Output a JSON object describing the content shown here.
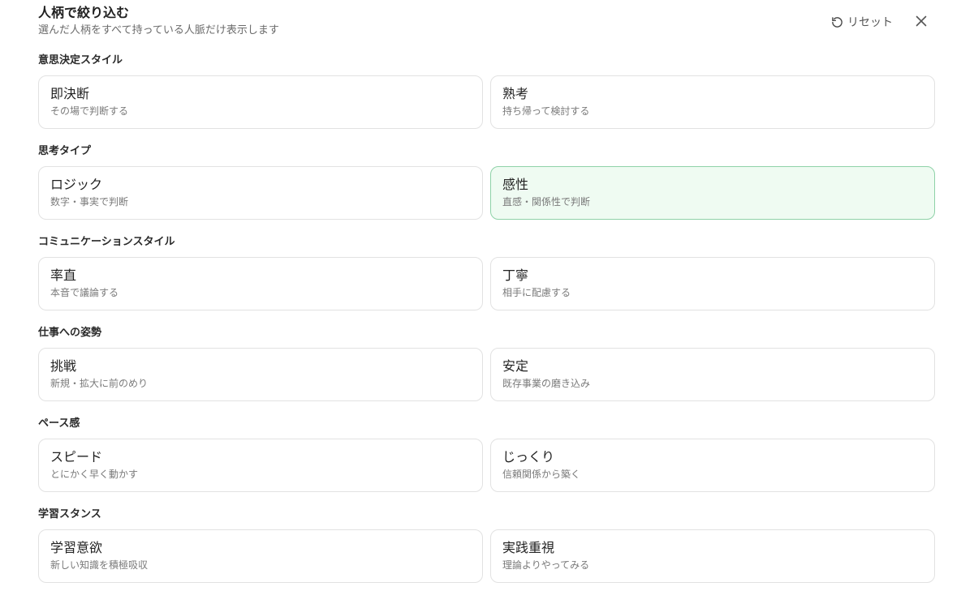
{
  "header": {
    "title": "人柄で絞り込む",
    "subtitle": "選んだ人柄をすべて持っている人脈だけ表示します",
    "reset_label": "リセット",
    "reset_icon": "rotate-ccw-icon",
    "close_icon": "close-icon"
  },
  "colors": {
    "selected_background": "#effbf2",
    "selected_border": "#8fd2a8",
    "card_border": "#e2e2e2"
  },
  "sections": [
    {
      "title": "意思決定スタイル",
      "options": [
        {
          "label": "即決断",
          "description": "その場で判断する",
          "selected": false
        },
        {
          "label": "熟考",
          "description": "持ち帰って検討する",
          "selected": false
        }
      ]
    },
    {
      "title": "思考タイプ",
      "options": [
        {
          "label": "ロジック",
          "description": "数字・事実で判断",
          "selected": false
        },
        {
          "label": "感性",
          "description": "直感・関係性で判断",
          "selected": true
        }
      ]
    },
    {
      "title": "コミュニケーションスタイル",
      "options": [
        {
          "label": "率直",
          "description": "本音で議論する",
          "selected": false
        },
        {
          "label": "丁寧",
          "description": "相手に配慮する",
          "selected": false
        }
      ]
    },
    {
      "title": "仕事への姿勢",
      "options": [
        {
          "label": "挑戦",
          "description": "新規・拡大に前のめり",
          "selected": false
        },
        {
          "label": "安定",
          "description": "既存事業の磨き込み",
          "selected": false
        }
      ]
    },
    {
      "title": "ペース感",
      "options": [
        {
          "label": "スピード",
          "description": "とにかく早く動かす",
          "selected": false
        },
        {
          "label": "じっくり",
          "description": "信頼関係から築く",
          "selected": false
        }
      ]
    },
    {
      "title": "学習スタンス",
      "options": [
        {
          "label": "学習意欲",
          "description": "新しい知識を積極吸収",
          "selected": false
        },
        {
          "label": "実践重視",
          "description": "理論よりやってみる",
          "selected": false
        }
      ]
    }
  ]
}
